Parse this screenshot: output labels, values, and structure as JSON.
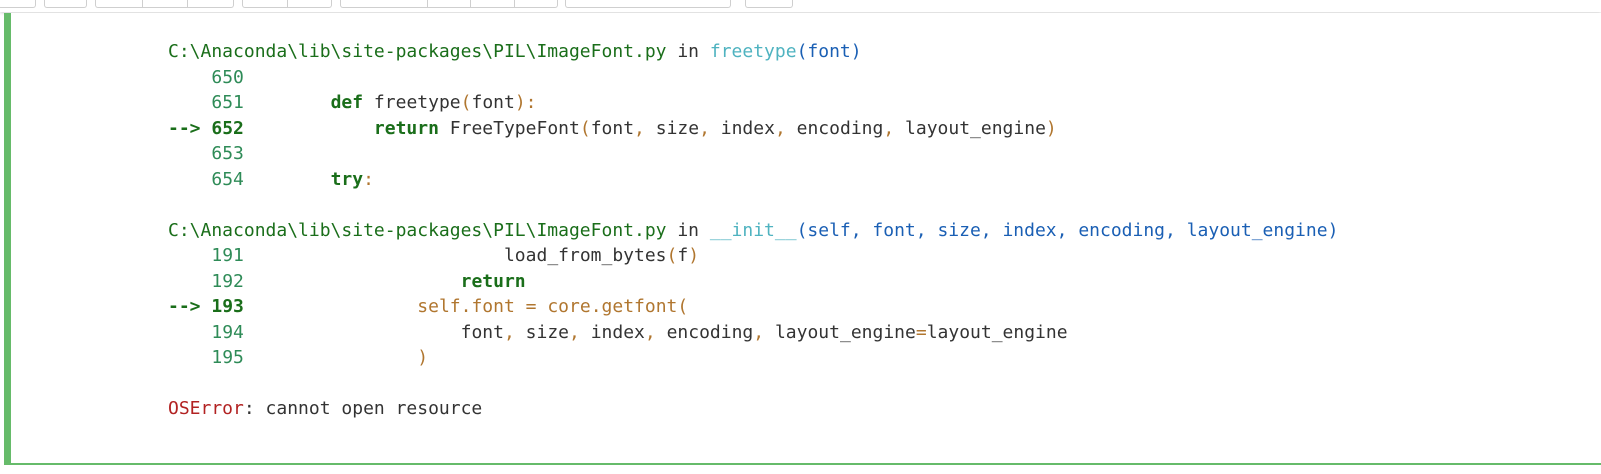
{
  "frames": [
    {
      "path": "C:\\Anaconda\\lib\\site-packages\\PIL\\ImageFont.py",
      "in": " in ",
      "func": "freetype",
      "args": "(font)",
      "lines": [
        {
          "marker": "    ",
          "num": "650",
          "indent": "",
          "parts": []
        },
        {
          "marker": "    ",
          "num": "651",
          "indent": "    ",
          "parts": [
            {
              "t": "def",
              "c": "kw"
            },
            {
              "t": " freetype",
              "c": "code"
            },
            {
              "t": "(",
              "c": "punct"
            },
            {
              "t": "font",
              "c": "code"
            },
            {
              "t": "):",
              "c": "punct"
            }
          ]
        },
        {
          "marker": "--> ",
          "num": "652",
          "current": true,
          "indent": "        ",
          "parts": [
            {
              "t": "return",
              "c": "kw"
            },
            {
              "t": " FreeTypeFont",
              "c": "code"
            },
            {
              "t": "(",
              "c": "punct"
            },
            {
              "t": "font",
              "c": "code"
            },
            {
              "t": ",",
              "c": "punct"
            },
            {
              "t": " size",
              "c": "code"
            },
            {
              "t": ",",
              "c": "punct"
            },
            {
              "t": " index",
              "c": "code"
            },
            {
              "t": ",",
              "c": "punct"
            },
            {
              "t": " encoding",
              "c": "code"
            },
            {
              "t": ",",
              "c": "punct"
            },
            {
              "t": " layout_engine",
              "c": "code"
            },
            {
              "t": ")",
              "c": "punct"
            }
          ]
        },
        {
          "marker": "    ",
          "num": "653",
          "indent": "",
          "parts": []
        },
        {
          "marker": "    ",
          "num": "654",
          "indent": "    ",
          "parts": [
            {
              "t": "try",
              "c": "kw"
            },
            {
              "t": ":",
              "c": "punct"
            }
          ]
        }
      ]
    },
    {
      "path": "C:\\Anaconda\\lib\\site-packages\\PIL\\ImageFont.py",
      "in": " in ",
      "func": "__init__",
      "args": "(self, font, size, index, encoding, layout_engine)",
      "lines": [
        {
          "marker": "    ",
          "num": "191",
          "indent": "                    ",
          "parts": [
            {
              "t": "load_from_bytes",
              "c": "code"
            },
            {
              "t": "(",
              "c": "punct"
            },
            {
              "t": "f",
              "c": "code"
            },
            {
              "t": ")",
              "c": "punct"
            }
          ]
        },
        {
          "marker": "    ",
          "num": "192",
          "indent": "                ",
          "parts": [
            {
              "t": "return",
              "c": "kw"
            }
          ]
        },
        {
          "marker": "--> ",
          "num": "193",
          "current": true,
          "indent": "            ",
          "parts": [
            {
              "t": "self",
              "c": "orange"
            },
            {
              "t": ".",
              "c": "punct"
            },
            {
              "t": "font ",
              "c": "orange"
            },
            {
              "t": "=",
              "c": "punct"
            },
            {
              "t": " core",
              "c": "orange"
            },
            {
              "t": ".",
              "c": "punct"
            },
            {
              "t": "getfont",
              "c": "orange"
            },
            {
              "t": "(",
              "c": "punct"
            }
          ]
        },
        {
          "marker": "    ",
          "num": "194",
          "indent": "                ",
          "parts": [
            {
              "t": "font",
              "c": "code"
            },
            {
              "t": ",",
              "c": "punct"
            },
            {
              "t": " size",
              "c": "code"
            },
            {
              "t": ",",
              "c": "punct"
            },
            {
              "t": " index",
              "c": "code"
            },
            {
              "t": ",",
              "c": "punct"
            },
            {
              "t": " encoding",
              "c": "code"
            },
            {
              "t": ",",
              "c": "punct"
            },
            {
              "t": " layout_engine",
              "c": "code"
            },
            {
              "t": "=",
              "c": "punct"
            },
            {
              "t": "layout_engine",
              "c": "code"
            }
          ]
        },
        {
          "marker": "    ",
          "num": "195",
          "indent": "            ",
          "parts": [
            {
              "t": ")",
              "c": "punct"
            }
          ]
        }
      ]
    }
  ],
  "error": {
    "type": "OSError",
    "message": ": cannot open resource"
  },
  "colors": {
    "cell_accent": "#66bb6a",
    "path": "#1a6e1a",
    "function": "#4fb3c0",
    "args": "#1a5fb4",
    "error": "#b22222"
  }
}
